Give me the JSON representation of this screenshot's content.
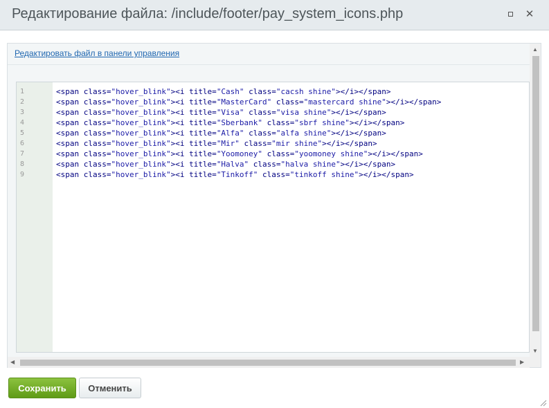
{
  "dialog": {
    "title": "Редактирование файла: /include/footer/pay_system_icons.php"
  },
  "panel": {
    "link_label": "Редактировать файл в панели управления"
  },
  "editor": {
    "lines": [
      {
        "num": "1",
        "title": "Cash",
        "cls": "cacsh shine"
      },
      {
        "num": "2",
        "title": "MasterCard",
        "cls": "mastercard shine"
      },
      {
        "num": "3",
        "title": "Visa",
        "cls": "visa shine"
      },
      {
        "num": "4",
        "title": "Sberbank",
        "cls": "sbrf shine"
      },
      {
        "num": "5",
        "title": "Alfa",
        "cls": "alfa shine"
      },
      {
        "num": "6",
        "title": "Mir",
        "cls": "mir shine"
      },
      {
        "num": "7",
        "title": "Yoomoney",
        "cls": "yoomoney shine"
      },
      {
        "num": "8",
        "title": "Halva",
        "cls": "halva shine"
      },
      {
        "num": "9",
        "title": "Tinkoff",
        "cls": "tinkoff shine"
      }
    ]
  },
  "buttons": {
    "save_label": "Сохранить",
    "cancel_label": "Отменить"
  },
  "colors": {
    "save_button": "#6aa81d",
    "link": "#2067b0"
  }
}
